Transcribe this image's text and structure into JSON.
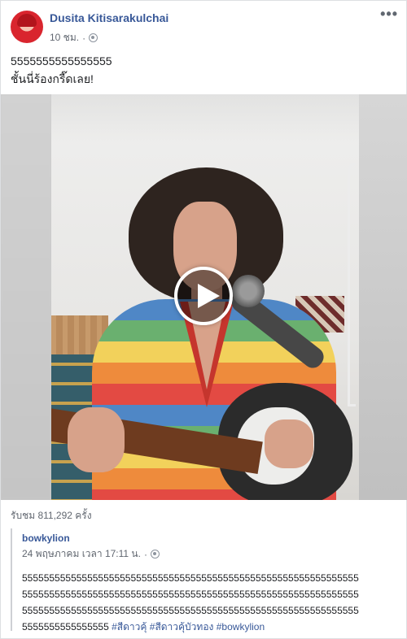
{
  "post": {
    "author": "Dusita Kitisarakulchai",
    "time": "10 ชม.",
    "separator": "·",
    "privacy_icon": "globe-icon",
    "more_icon": "more-options-icon",
    "more_glyph": "•••",
    "text_line1": "5555555555555555",
    "text_line2": "ชั้นนี่ร้องกรี๊ดเลย!",
    "views": "รับชม 811,292 ครั้ง"
  },
  "video": {
    "play_icon": "play-icon"
  },
  "shared": {
    "author": "bowkylion",
    "date": "24 พฤษภาคม เวลา 17:11 น.",
    "separator": "·",
    "privacy_icon": "globe-icon",
    "lines": [
      "55555555555555555555555555555555555555555555555555555555555555",
      "55555555555555555555555555555555555555555555555555555555555555",
      "55555555555555555555555555555555555555555555555555555555555555",
      "5555555555555555"
    ],
    "hashtags": [
      "#สีดาวคุ้",
      "#สีดาวคุ้บัวทอง",
      "#bowkylion"
    ]
  }
}
